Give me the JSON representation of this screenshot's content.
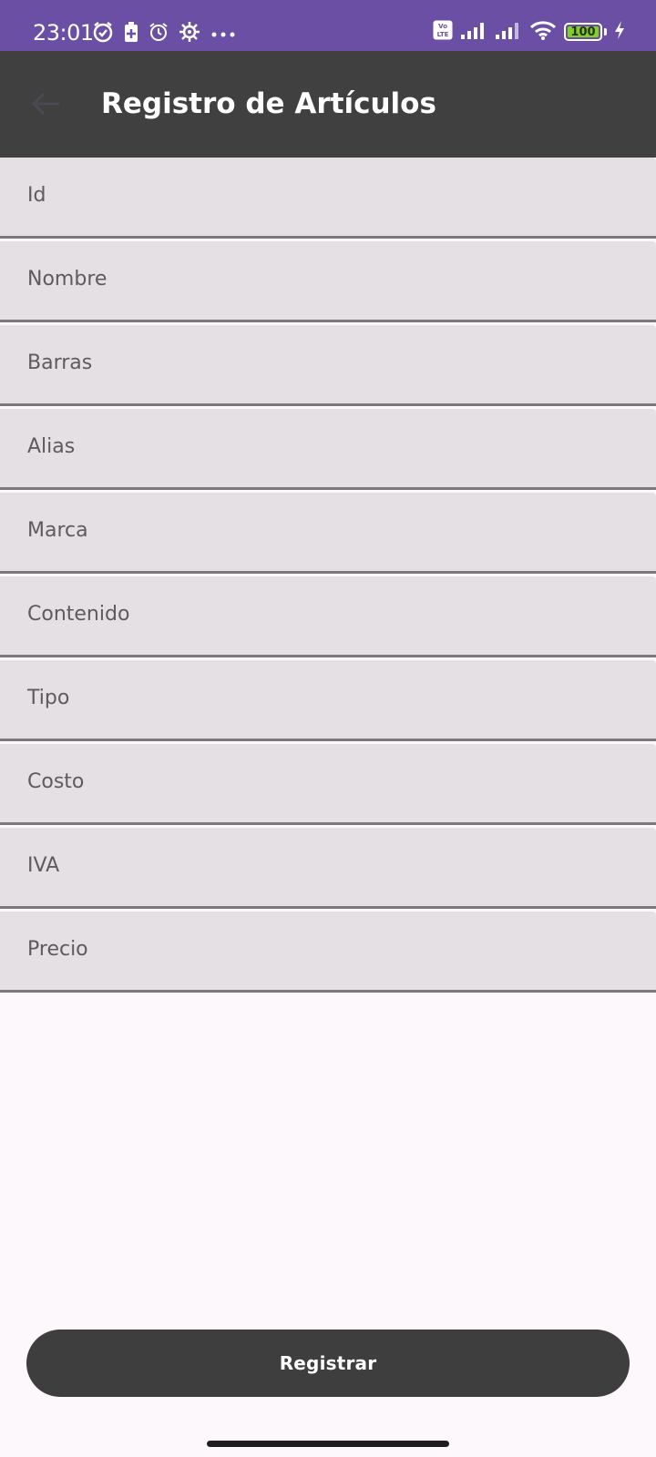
{
  "status_bar": {
    "time": "23:01",
    "battery_level": "100",
    "volte_label": "Vo LTE",
    "left_icons": [
      "alarm-check-icon",
      "battery-saver-icon",
      "alarm-icon",
      "gear-icon",
      "more-dots-icon"
    ],
    "right_icons": [
      "volte-icon",
      "signal-icon",
      "signal-icon",
      "wifi-icon",
      "battery-icon",
      "charging-icon"
    ],
    "background": "#6a4fa4",
    "battery_fill": "#7ed321"
  },
  "app_bar": {
    "title": "Registro de Artículos",
    "back_icon": "arrow-left-icon",
    "background": "#404040"
  },
  "form": {
    "fields": [
      {
        "label": "Id"
      },
      {
        "label": "Nombre"
      },
      {
        "label": "Barras"
      },
      {
        "label": "Alias"
      },
      {
        "label": "Marca"
      },
      {
        "label": "Contenido"
      },
      {
        "label": "Tipo"
      },
      {
        "label": "Costo"
      },
      {
        "label": "IVA"
      },
      {
        "label": "Precio"
      }
    ]
  },
  "actions": {
    "register_label": "Registrar"
  }
}
